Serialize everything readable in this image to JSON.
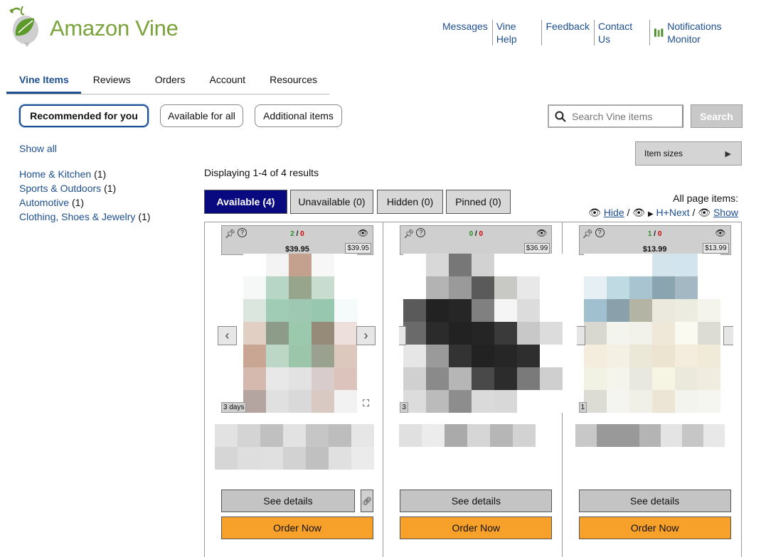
{
  "brand": {
    "name": "Amazon Vine"
  },
  "toplinks": [
    "Messages",
    "Vine Help",
    "Feedback",
    "Contact Us",
    "Notifications Monitor"
  ],
  "nav": {
    "tabs": [
      "Vine Items",
      "Reviews",
      "Orders",
      "Account",
      "Resources"
    ],
    "active": "Vine Items"
  },
  "queues": {
    "recommended": "Recommended for you",
    "all": "Available for all",
    "additional": "Additional items"
  },
  "search": {
    "placeholder": "Search Vine items",
    "button": "Search"
  },
  "sidebar": {
    "show_all": "Show all",
    "categories": [
      {
        "name": "Home & Kitchen",
        "count": "(1)"
      },
      {
        "name": "Sports & Outdoors",
        "count": "(1)"
      },
      {
        "name": "Automotive",
        "count": "(1)"
      },
      {
        "name": "Clothing, Shoes & Jewelry",
        "count": "(1)"
      }
    ]
  },
  "item_sizes": "Item sizes",
  "results_text": "Displaying 1-4 of 4 results",
  "filter_tabs": {
    "available": "Available (4)",
    "unavailable": "Unavailable (0)",
    "hidden": "Hidden (0)",
    "pinned": "Pinned (0)"
  },
  "page_items": {
    "label": "All page items:",
    "hide": "Hide",
    "hide_next": "H+Next",
    "show": "Show",
    "sep": "/"
  },
  "cards": [
    {
      "good": "2",
      "bad": "0",
      "price": "$39.95",
      "price_small": "$39.95",
      "days": "3 days",
      "details": "See details",
      "order": "Order Now"
    },
    {
      "good": "0",
      "bad": "0",
      "price": "",
      "price_small": "$36.99",
      "days": "3",
      "details": "See details",
      "order": "Order Now"
    },
    {
      "good": "1",
      "bad": "0",
      "price": "$13.99",
      "price_small": "$13.99",
      "days": "1",
      "details": "See details",
      "order": "Order Now"
    }
  ],
  "colors": {
    "link": "#1d4f91",
    "active_tab": "#0a0a80",
    "order_btn": "#f7a02a",
    "good": "#2a8a2a",
    "bad": "#d40000",
    "logo": "#7aa33a"
  }
}
